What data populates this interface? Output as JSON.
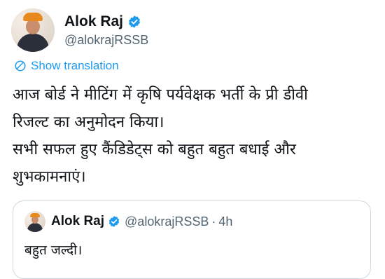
{
  "author": {
    "name": "Alok Raj",
    "handle": "@alokrajRSSB",
    "verified_icon": "verified-badge-icon"
  },
  "translate": {
    "icon": "translate-globe-icon",
    "label": "Show translation"
  },
  "tweet": {
    "lines": [
      "आज बोर्ड ने मीटिंग में कृषि पर्यवेक्षक भर्ती के प्री डीवी",
      "रिजल्ट का अनुमोदन किया।",
      "सभी सफल हुए कैंडिडेट्स को बहुत बहुत बधाई और",
      "शुभकामनाएं।"
    ]
  },
  "quote": {
    "name": "Alok Raj",
    "handle": "@alokrajRSSB",
    "separator": "·",
    "time": "4h",
    "text": "बहुत जल्दी।"
  },
  "colors": {
    "accent": "#1d9bf0",
    "text": "#0f1419",
    "muted": "#536471",
    "border": "#cfd9de"
  }
}
